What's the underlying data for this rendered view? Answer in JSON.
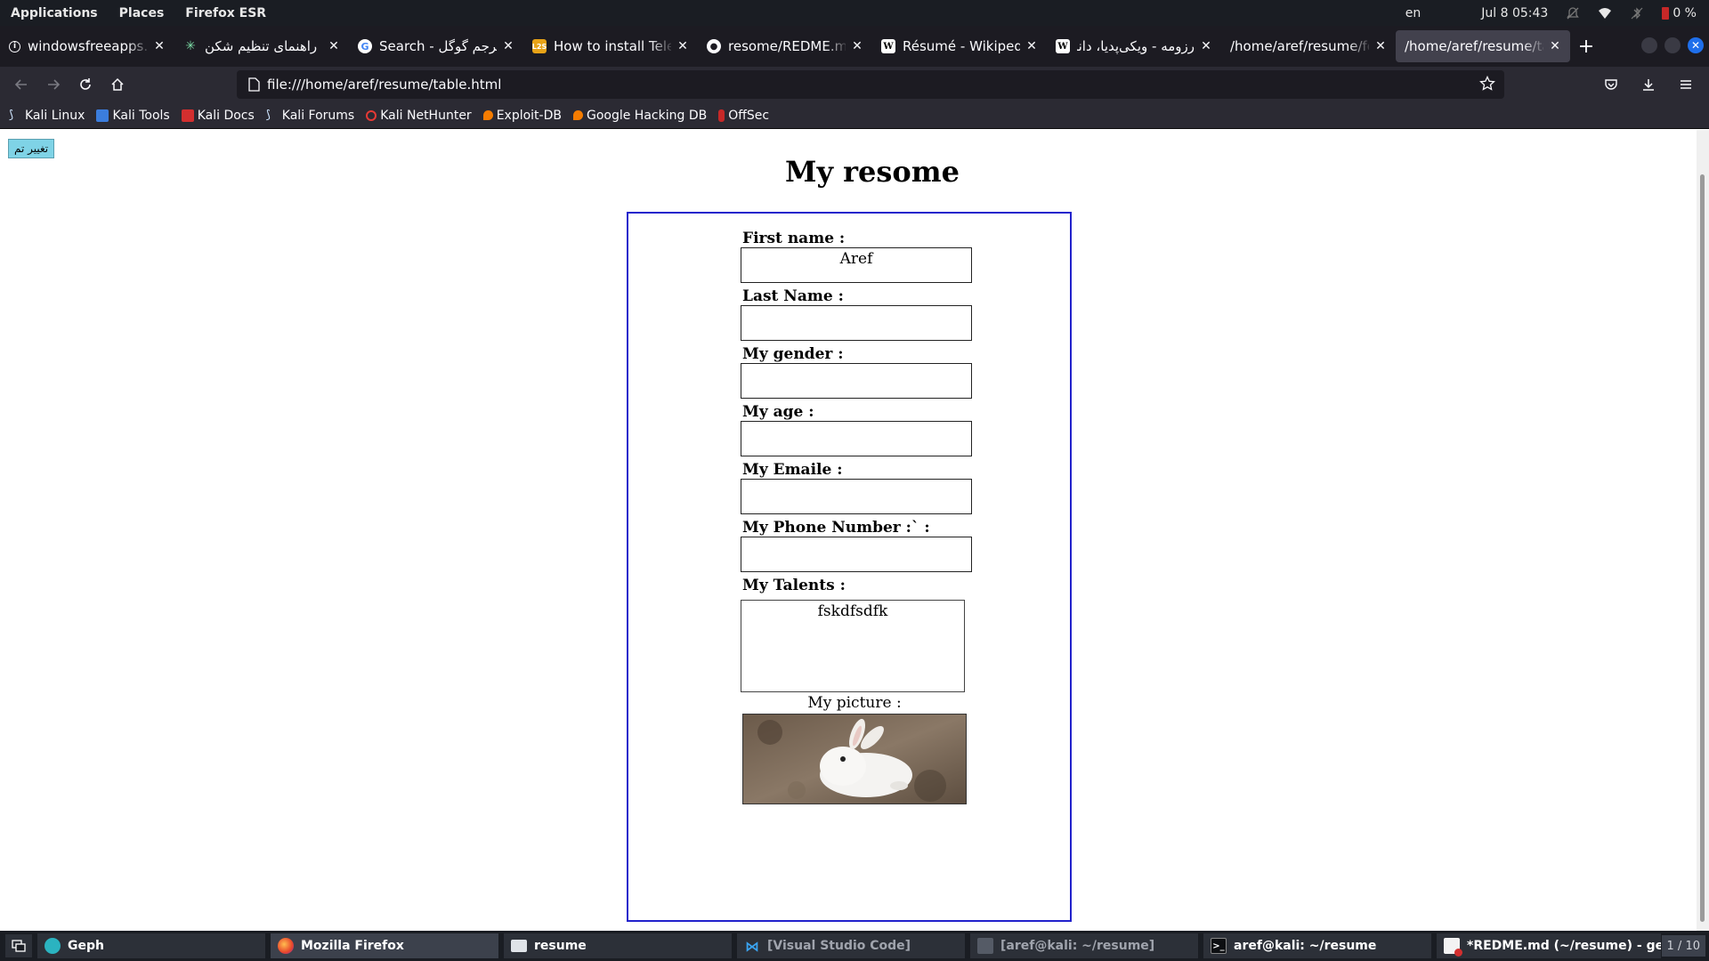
{
  "topbar": {
    "menus": [
      "Applications",
      "Places",
      "Firefox ESR"
    ],
    "language": "en",
    "datetime": "Jul 8  05:43",
    "battery": "0 %"
  },
  "tabs": [
    {
      "title": "windowsfreeapps.com",
      "favicon": "info-icon",
      "active": false
    },
    {
      "title": "راهنمای تنظیم شکن",
      "favicon": "star-burst-icon",
      "active": false
    },
    {
      "title": "Search - مترجم گوگل",
      "favicon": "google-icon",
      "active": false
    },
    {
      "title": "How to install Telegram",
      "favicon": "l2s-icon",
      "active": false
    },
    {
      "title": "resome/REDME.md at main",
      "favicon": "github-icon",
      "active": false
    },
    {
      "title": "Résumé - Wikipedia",
      "favicon": "wikipedia-icon",
      "active": false
    },
    {
      "title": "رزومه - ویکی‌پدیا، دانشنامهٔ آزاد",
      "favicon": "wikipedia-icon",
      "active": false
    },
    {
      "title": "/home/aref/resume/form.html",
      "favicon": "",
      "active": false
    },
    {
      "title": "/home/aref/resume/table.html",
      "favicon": "",
      "active": true
    }
  ],
  "navbar": {
    "url": "file:///home/aref/resume/table.html"
  },
  "bookmarks": [
    {
      "label": "Kali Linux",
      "icon": "kali-dragon-icon"
    },
    {
      "label": "Kali Tools",
      "icon": "kali-tools-icon"
    },
    {
      "label": "Kali Docs",
      "icon": "kali-docs-icon"
    },
    {
      "label": "Kali Forums",
      "icon": "kali-dragon-icon"
    },
    {
      "label": "Kali NetHunter",
      "icon": "nethunter-icon"
    },
    {
      "label": "Exploit-DB",
      "icon": "exploitdb-icon"
    },
    {
      "label": "Google Hacking DB",
      "icon": "exploitdb-icon"
    },
    {
      "label": "OffSec",
      "icon": "offsec-icon"
    }
  ],
  "page": {
    "theme_button": "تغییر تم",
    "heading": "My resome",
    "fields": [
      {
        "label": "First name :",
        "value": "Aref"
      },
      {
        "label": "Last Name :",
        "value": ""
      },
      {
        "label": "My gender :",
        "value": ""
      },
      {
        "label": "My age :",
        "value": ""
      },
      {
        "label": "My Emaile :",
        "value": ""
      },
      {
        "label": "My Phone Number :` :",
        "value": ""
      }
    ],
    "talents_label": "My Talents :",
    "talents_value": "fskdfsdfk",
    "picture_label": "My picture :",
    "picture_subject": "white-rabbit-photo"
  },
  "taskbar": {
    "tasks": [
      {
        "label": "Geph",
        "icon": "geph-icon",
        "state": "normal"
      },
      {
        "label": "Mozilla Firefox",
        "icon": "firefox-icon",
        "state": "active"
      },
      {
        "label": "resume",
        "icon": "folder-icon",
        "state": "normal"
      },
      {
        "label": "[Visual Studio Code]",
        "icon": "vscode-icon",
        "state": "dim"
      },
      {
        "label": "[aref@kali: ~/resume]",
        "icon": "terminal-icon",
        "state": "dim"
      },
      {
        "label": "aref@kali: ~/resume",
        "icon": "terminal-icon",
        "state": "normal"
      },
      {
        "label": "*REDME.md (~/resume) - gedit",
        "icon": "gedit-icon",
        "state": "normal"
      }
    ],
    "pager": "1 / 10"
  },
  "colors": {
    "box_border": "#2222cc",
    "theme_button_bg": "#7fd3e6",
    "tab_active": "#42414d",
    "toolbar": "#2b2a33"
  }
}
